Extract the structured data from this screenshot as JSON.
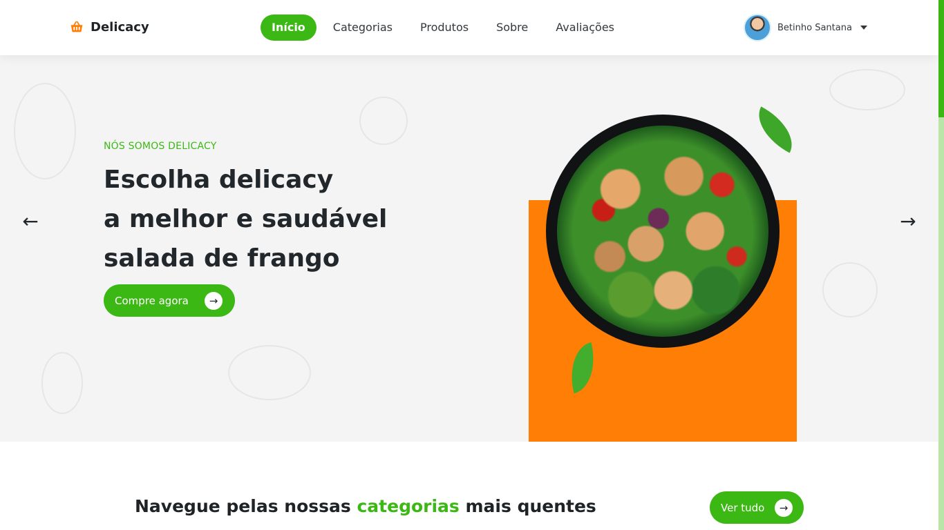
{
  "header": {
    "brand": "Delicacy",
    "nav": [
      {
        "label": "Início"
      },
      {
        "label": "Categorias"
      },
      {
        "label": "Produtos"
      },
      {
        "label": "Sobre"
      },
      {
        "label": "Avaliações"
      }
    ],
    "user_name": "Betinho Santana"
  },
  "hero": {
    "eyebrow": "NÓS SOMOS DELICACY",
    "headline": [
      "Escolha delicacy",
      "a melhor e saudável",
      "salada de frango"
    ],
    "cta": "Compre agora",
    "prev_icon": "←",
    "next_icon": "→"
  },
  "categories": {
    "title_prefix": "Navegue pelas nossas ",
    "title_highlight": "categorias",
    "title_suffix": " mais quentes",
    "see_all": "Ver tudo"
  },
  "colors": {
    "accent": "#3cb815",
    "orange": "#ff7f06",
    "dark_text": "#22272b",
    "hero_bg": "#f4f4f4"
  },
  "icons": {
    "brand": "basket-icon",
    "cta": "arrow-right-icon",
    "caret": "caret-down-icon"
  }
}
